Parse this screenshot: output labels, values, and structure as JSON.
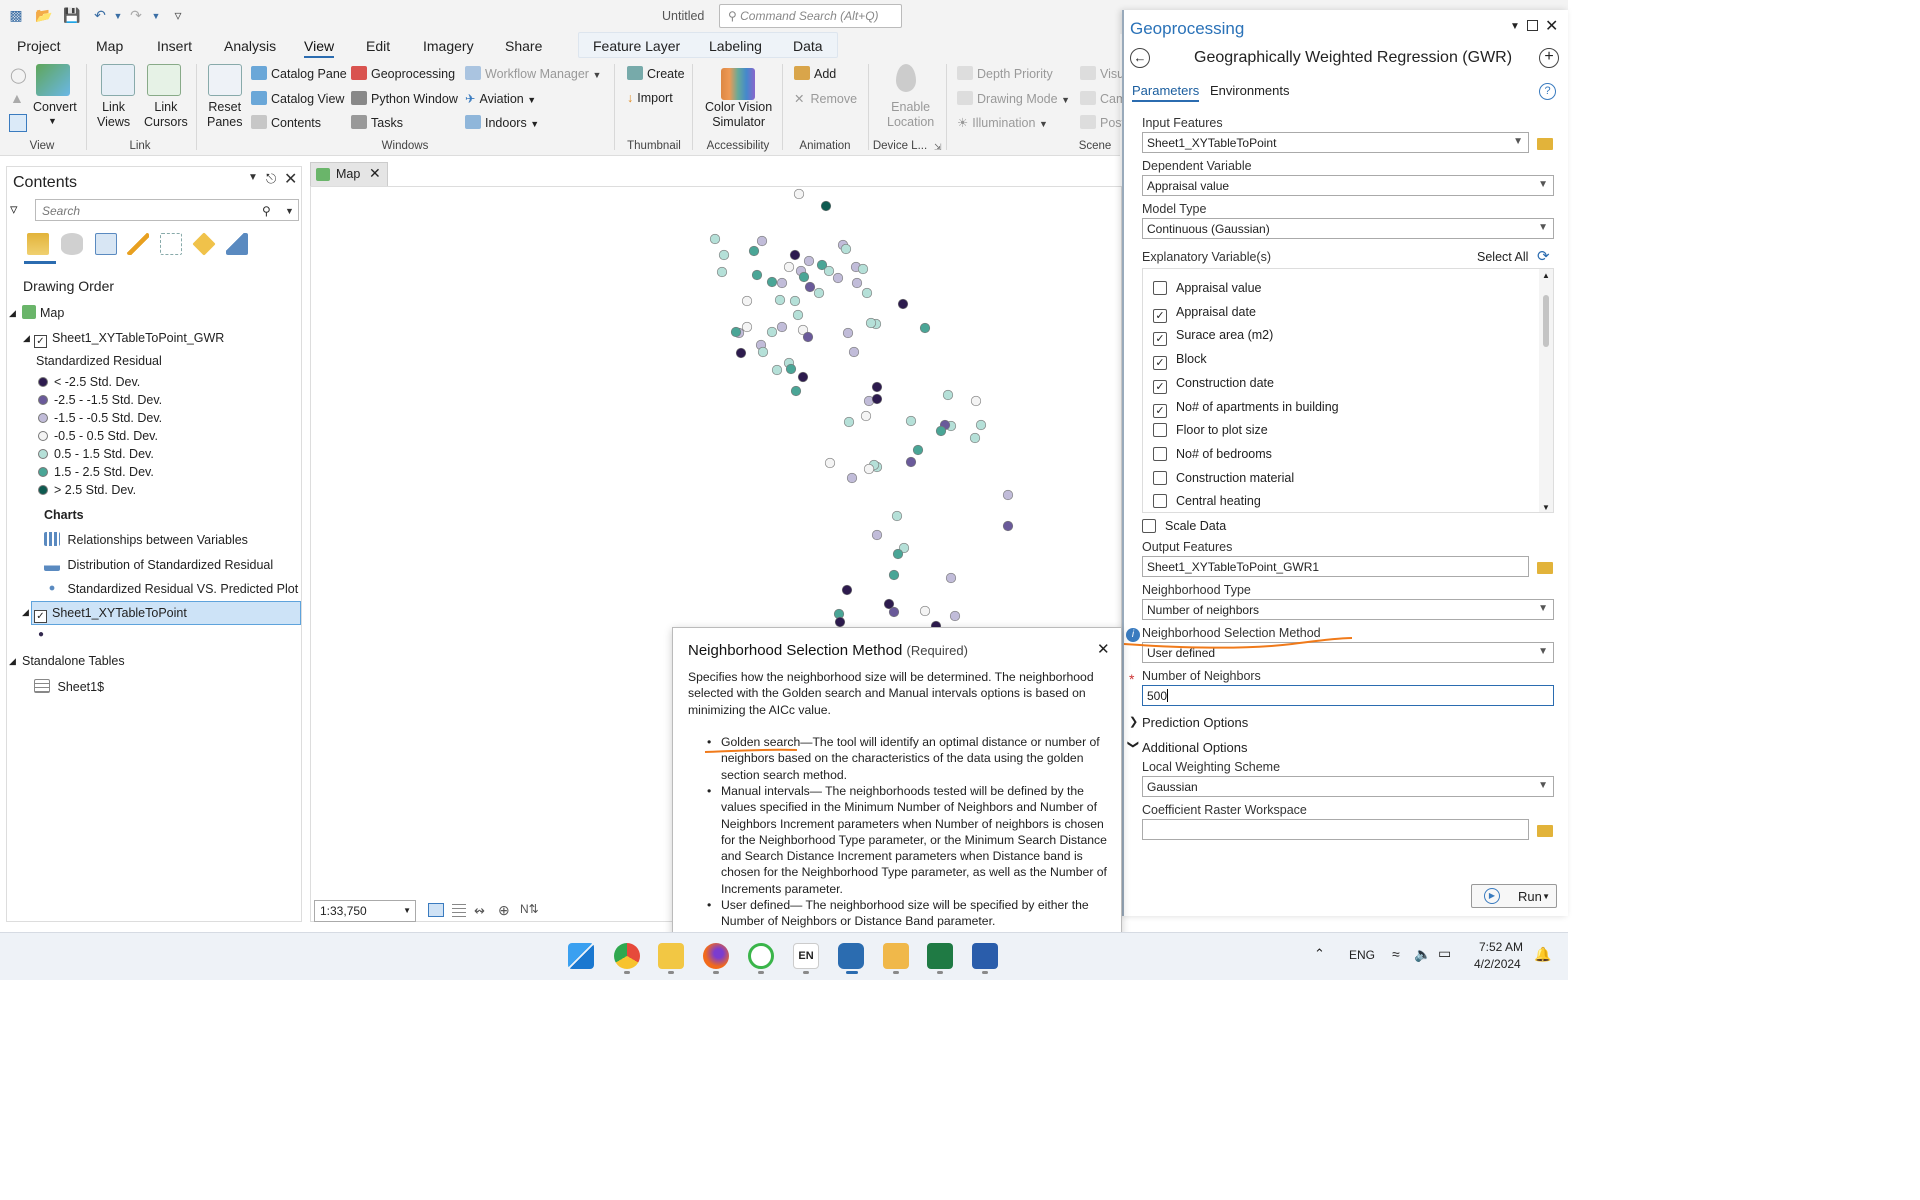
{
  "app": {
    "title": "Untitled",
    "command_search_placeholder": "Command Search (Alt+Q)"
  },
  "menu_tabs": [
    "Project",
    "Map",
    "Insert",
    "Analysis",
    "View",
    "Edit",
    "Imagery",
    "Share"
  ],
  "context_tabs": [
    "Feature Layer",
    "Labeling",
    "Data"
  ],
  "ribbon": {
    "view_group": {
      "convert": "Convert",
      "label": "View"
    },
    "link_group": {
      "link_views": "Link\nViews",
      "link_cursors": "Link\nCursors",
      "label": "Link"
    },
    "windows_group": {
      "reset_panes": "Reset\nPanes",
      "catalog_pane": "Catalog Pane",
      "catalog_view": "Catalog View",
      "contents": "Contents",
      "geoprocessing": "Geoprocessing",
      "python_window": "Python Window",
      "tasks": "Tasks",
      "workflow_manager": "Workflow Manager",
      "aviation": "Aviation",
      "indoors": "Indoors",
      "label": "Windows"
    },
    "thumbnail_group": {
      "create": "Create",
      "import": "Import",
      "label": "Thumbnail"
    },
    "accessibility_group": {
      "color_vision": "Color Vision\nSimulator",
      "label": "Accessibility"
    },
    "animation_group": {
      "add": "Add",
      "remove": "Remove",
      "label": "Animation"
    },
    "device_group": {
      "enable_location": "Enable\nLocation",
      "label": "Device L..."
    },
    "scene_group": {
      "depth_priority": "Depth Priority",
      "drawing_mode": "Drawing Mode",
      "illumination": "Illumination",
      "visu": "Visu",
      "cam": "Cam",
      "post": "Post",
      "label": "Scene"
    }
  },
  "contents": {
    "title": "Contents",
    "search_placeholder": "Search",
    "drawing_order": "Drawing Order",
    "map": "Map",
    "layer_gwr": "Sheet1_XYTableToPoint_GWR",
    "std_residual": "Standardized Residual",
    "legend": [
      {
        "label": "< -2.5 Std. Dev.",
        "color": "#2d1b4e"
      },
      {
        "label": "-2.5 - -1.5 Std. Dev.",
        "color": "#6a5a9a"
      },
      {
        "label": "-1.5 - -0.5 Std. Dev.",
        "color": "#c1bcd9"
      },
      {
        "label": "-0.5 - 0.5 Std. Dev.",
        "color": "#f4f4f4"
      },
      {
        "label": "0.5 - 1.5 Std. Dev.",
        "color": "#b5e0d8"
      },
      {
        "label": "1.5 - 2.5 Std. Dev.",
        "color": "#4aa596"
      },
      {
        "label": "> 2.5 Std. Dev.",
        "color": "#0e5a50"
      }
    ],
    "charts_label": "Charts",
    "charts": [
      "Relationships between Variables",
      "Distribution of Standardized Residual",
      "Standardized Residual VS. Predicted Plot"
    ],
    "layer_points": "Sheet1_XYTableToPoint",
    "standalone_tables": "Standalone Tables",
    "table": "Sheet1$"
  },
  "map": {
    "tab": "Map",
    "scale": "1:33,750"
  },
  "geoprocessing": {
    "pane_title": "Geoprocessing",
    "tool_title": "Geographically Weighted Regression (GWR)",
    "tabs": [
      "Parameters",
      "Environments"
    ],
    "input_features_label": "Input Features",
    "input_features": "Sheet1_XYTableToPoint",
    "dependent_variable_label": "Dependent Variable",
    "dependent_variable": "Appraisal value",
    "model_type_label": "Model Type",
    "model_type": "Continuous (Gaussian)",
    "explanatory_label": "Explanatory Variable(s)",
    "select_all": "Select All",
    "explanatory": [
      {
        "label": "Appraisal value",
        "checked": false
      },
      {
        "label": "Appraisal date",
        "checked": true
      },
      {
        "label": "Surace area (m2)",
        "checked": true
      },
      {
        "label": "Block",
        "checked": true
      },
      {
        "label": "Construction date",
        "checked": true
      },
      {
        "label": "No# of apartments in building",
        "checked": true
      },
      {
        "label": "Floor to plot size",
        "checked": false
      },
      {
        "label": "No# of bedrooms",
        "checked": false
      },
      {
        "label": "Construction material",
        "checked": false
      },
      {
        "label": "Central heating",
        "checked": false
      }
    ],
    "scale_data": "Scale Data",
    "output_features_label": "Output Features",
    "output_features": "Sheet1_XYTableToPoint_GWR1",
    "neighborhood_type_label": "Neighborhood Type",
    "neighborhood_type": "Number of neighbors",
    "neighborhood_selection_label": "Neighborhood Selection Method",
    "neighborhood_selection": "User defined",
    "number_of_neighbors_label": "Number of Neighbors",
    "number_of_neighbors": "500",
    "prediction_options": "Prediction Options",
    "additional_options": "Additional Options",
    "local_weighting_label": "Local Weighting Scheme",
    "local_weighting": "Gaussian",
    "coef_raster_label": "Coefficient Raster Workspace",
    "coef_raster": "",
    "run": "Run"
  },
  "popup": {
    "title": "Neighborhood Selection Method",
    "required": "(Required)",
    "intro": "Specifies how the neighborhood size will be determined. The neighborhood selected with the Golden search and Manual intervals options is based on minimizing the AICc value.",
    "bullets": [
      {
        "term": "Golden search",
        "text": "—The tool will identify an optimal distance or number of neighbors based on the characteristics of the data using the golden section search method."
      },
      {
        "term": "Manual intervals",
        "text": "— The neighborhoods tested will be defined by the values specified in the Minimum Number of Neighbors and Number of Neighbors Increment parameters when Number of neighbors is chosen for the Neighborhood Type parameter, or the Minimum Search Distance and Search Distance Increment parameters when Distance band is chosen for the Neighborhood Type parameter, as well as the Number of Increments parameter."
      },
      {
        "term": "User defined",
        "text": "— The neighborhood size will be specified by either the Number of Neighbors or Distance Band parameter."
      }
    ]
  },
  "taskbar": {
    "lang_icon": "EN",
    "lang": "ENG",
    "time": "7:52 AM",
    "date": "4/2/2024"
  }
}
